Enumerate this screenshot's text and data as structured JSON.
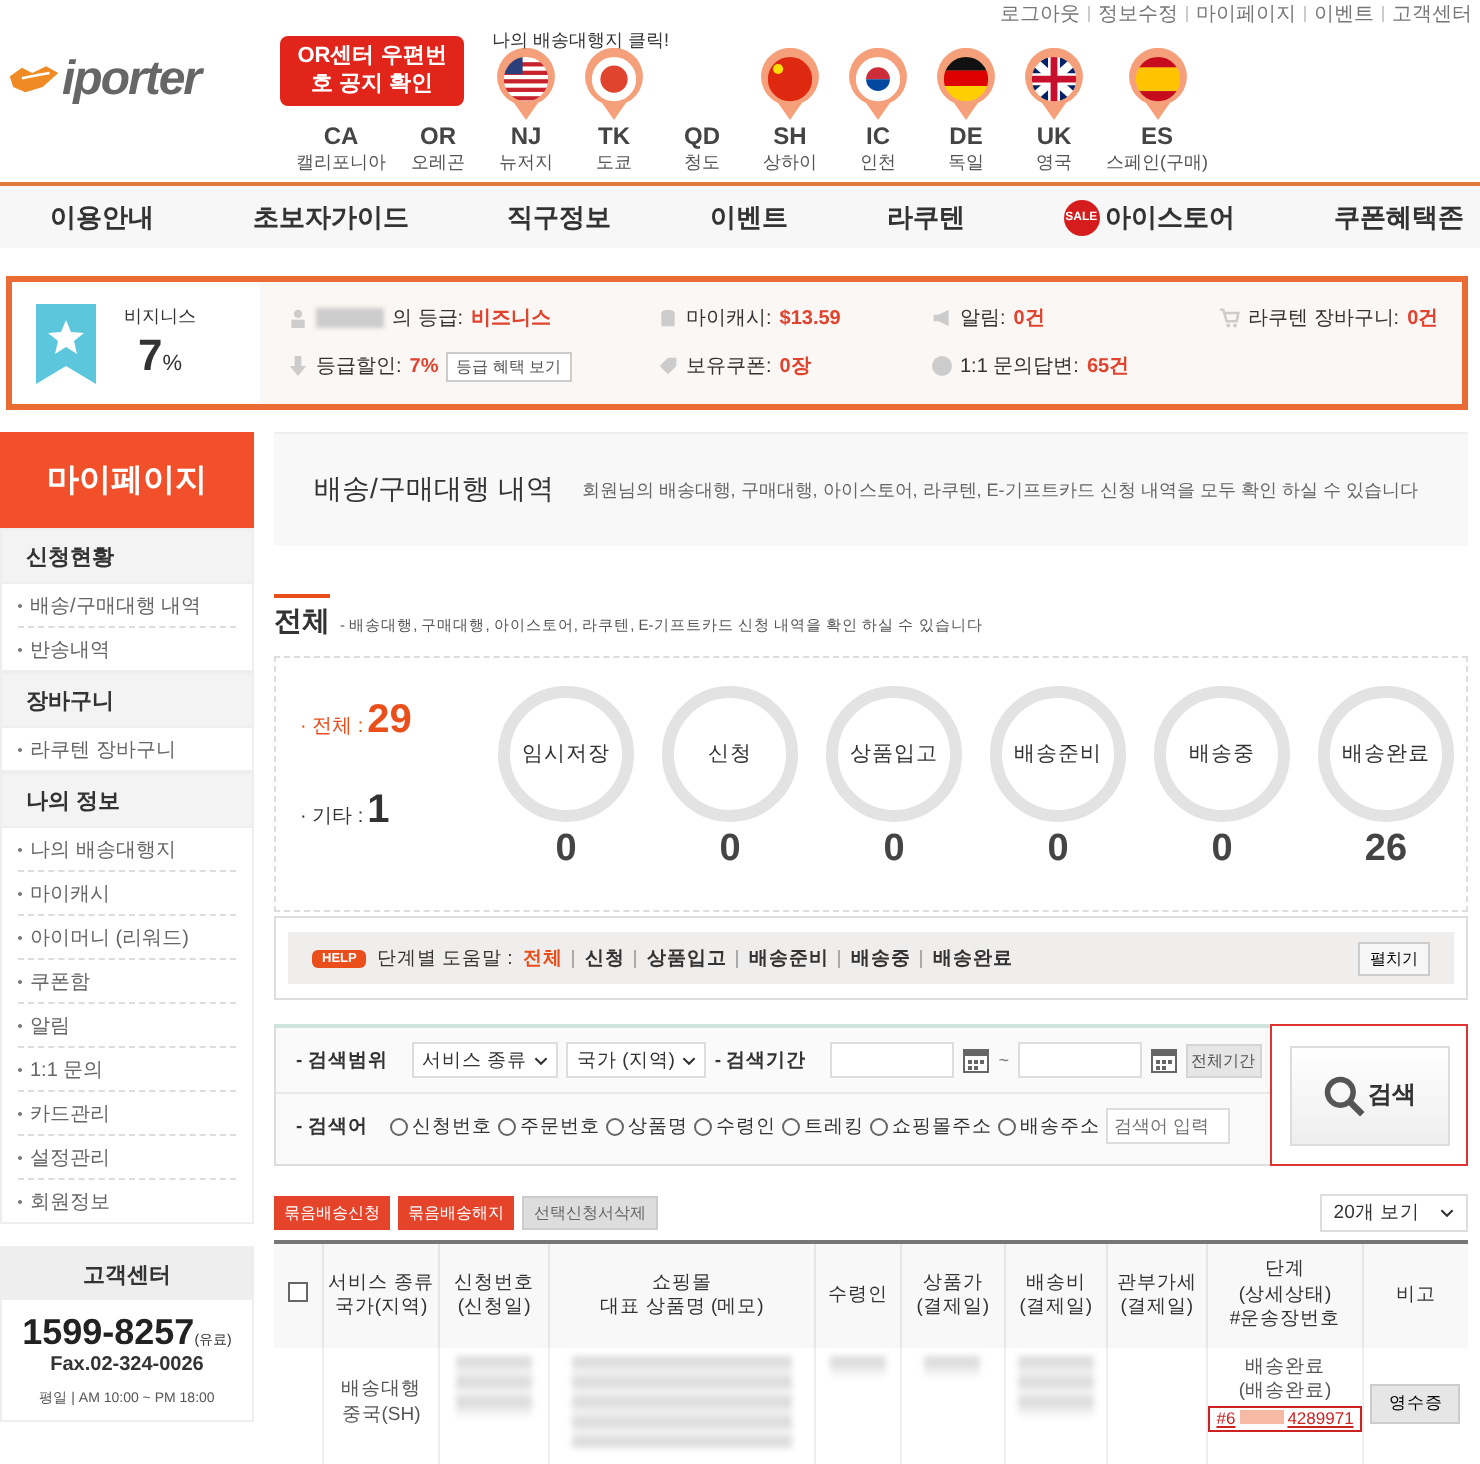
{
  "header": {
    "util_links": [
      "로그아웃",
      "정보수정",
      "마이페이지",
      "이벤트",
      "고객센터"
    ],
    "logo": "iporter",
    "notice": "OR센터 우편번호 공지 확인",
    "hint": "나의 배송대행지 클릭!",
    "locations": [
      {
        "code": "CA",
        "name": "캘리포니아",
        "has_flag": false
      },
      {
        "code": "OR",
        "name": "오레곤",
        "has_flag": false
      },
      {
        "code": "NJ",
        "name": "뉴저지",
        "has_flag": true
      },
      {
        "code": "TK",
        "name": "도쿄",
        "has_flag": true
      },
      {
        "code": "QD",
        "name": "청도",
        "has_flag": false
      },
      {
        "code": "SH",
        "name": "상하이",
        "has_flag": true
      },
      {
        "code": "IC",
        "name": "인천",
        "has_flag": true
      },
      {
        "code": "DE",
        "name": "독일",
        "has_flag": true
      },
      {
        "code": "UK",
        "name": "영국",
        "has_flag": true
      },
      {
        "code": "ES",
        "name": "스페인(구매)",
        "has_flag": true
      }
    ]
  },
  "nav": [
    {
      "label": "이용안내"
    },
    {
      "label": "초보자가이드"
    },
    {
      "label": "직구정보"
    },
    {
      "label": "이벤트"
    },
    {
      "label": "라쿠텐"
    },
    {
      "label": "아이스토어",
      "badge": "SALE"
    },
    {
      "label": "쿠폰혜택존"
    }
  ],
  "member": {
    "grade": "비지니스",
    "rate": "7",
    "unit": "%",
    "items": [
      {
        "label": "의 등급:",
        "value": "비즈니스"
      },
      {
        "label": "마이캐시:",
        "value": "$13.59"
      },
      {
        "label": "알림:",
        "value": "0건"
      },
      {
        "label": "라쿠텐 장바구니:",
        "value": "0건"
      },
      {
        "label": "등급할인:",
        "value": "7%",
        "button": "등급 혜택 보기"
      },
      {
        "label": "보유쿠폰:",
        "value": "0장"
      },
      {
        "label": "1:1 문의답변:",
        "value": "65건"
      }
    ]
  },
  "sidebar": {
    "title": "마이페이지",
    "sections": [
      {
        "title": "신청현황",
        "items": [
          "배송/구매대행 내역",
          "반송내역"
        ]
      },
      {
        "title": "장바구니",
        "items": [
          "라쿠텐 장바구니"
        ]
      },
      {
        "title": "나의 정보",
        "items": [
          "나의 배송대행지",
          "마이캐시",
          "아이머니 (리워드)",
          "쿠폰함",
          "알림",
          "1:1 문의",
          "카드관리",
          "설정관리",
          "회원정보"
        ]
      }
    ],
    "support": {
      "title": "고객센터",
      "phone": "1599-8257",
      "phone_note": "(유료)",
      "fax": "Fax.02-324-0026",
      "hours": "평일 | AM 10:00 ~ PM 18:00"
    }
  },
  "page": {
    "title": "배송/구매대행 내역",
    "description": "회원님의 배송대행, 구매대행, 아이스토어, 라쿠텐, E-기프트카드 신청 내역을 모두 확인 하실 수 있습니다",
    "section": "전체",
    "section_note": "- 배송대행, 구매대행, 아이스토어, 라쿠텐, E-기프트카드 신청 내역을 확인 하실 수 있습니다",
    "totals": [
      {
        "kind": "main",
        "label": "· 전체 :",
        "value": "29"
      },
      {
        "kind": "other",
        "label": "· 기타 :",
        "value": "1"
      }
    ],
    "stages": [
      {
        "label": "임시저장",
        "count": "0"
      },
      {
        "label": "신청",
        "count": "0"
      },
      {
        "label": "상품입고",
        "count": "0"
      },
      {
        "label": "배송준비",
        "count": "0"
      },
      {
        "label": "배송중",
        "count": "0"
      },
      {
        "label": "배송완료",
        "count": "26"
      }
    ],
    "help": {
      "badge": "HELP",
      "label": "단계별 도움말 :",
      "links": [
        {
          "label": "전체",
          "selected": true
        },
        {
          "label": "신청",
          "selected": false
        },
        {
          "label": "상품입고",
          "selected": false
        },
        {
          "label": "배송준비",
          "selected": false
        },
        {
          "label": "배송중",
          "selected": false
        },
        {
          "label": "배송완료",
          "selected": false
        }
      ],
      "button": "펼치기"
    }
  },
  "search": {
    "scope_label": "- 검색범위",
    "selects": [
      "서비스 종류",
      "국가 (지역)"
    ],
    "period_label": "- 검색기간",
    "tilde": "~",
    "all_period": "전체기간",
    "keyword_label": "- 검색어",
    "options": [
      {
        "label": "신청번호",
        "selected": false
      },
      {
        "label": "주문번호",
        "selected": false
      },
      {
        "label": "상품명",
        "selected": false
      },
      {
        "label": "수령인",
        "selected": false
      },
      {
        "label": "트레킹",
        "selected": false
      },
      {
        "label": "쇼핑몰주소",
        "selected": false
      },
      {
        "label": "배송주소",
        "selected": false
      }
    ],
    "placeholder": "검색어 입력",
    "button": "검색"
  },
  "actions": {
    "buttons": [
      {
        "kind": "primary",
        "label": "묶음배송신청"
      },
      {
        "kind": "primary",
        "label": "묶음배송해지"
      },
      {
        "kind": "disabled",
        "label": "선택신청서삭제"
      }
    ],
    "page_size": "20개 보기"
  },
  "table": {
    "select_all": {
      "checked": false
    },
    "columns": [
      [
        "서비스 종류",
        "국가(지역)"
      ],
      [
        "신청번호",
        "(신청일)"
      ],
      [
        "쇼핑몰",
        "대표 상품명 (메모)"
      ],
      [
        "수령인"
      ],
      [
        "상품가",
        "(결제일)"
      ],
      [
        "배송비",
        "(결제일)"
      ],
      [
        "관부가세",
        "(결제일)"
      ],
      [
        "단계",
        "(상세상태)",
        "#운송장번호"
      ],
      [
        "비고"
      ]
    ],
    "rows": [
      {
        "service": "배송대행",
        "country": "중국(SH)",
        "stage": "배송완료",
        "detail": "(배송완료)",
        "tracking_start": "#6",
        "tracking_end": "4289971",
        "button": "영수증"
      }
    ]
  }
}
